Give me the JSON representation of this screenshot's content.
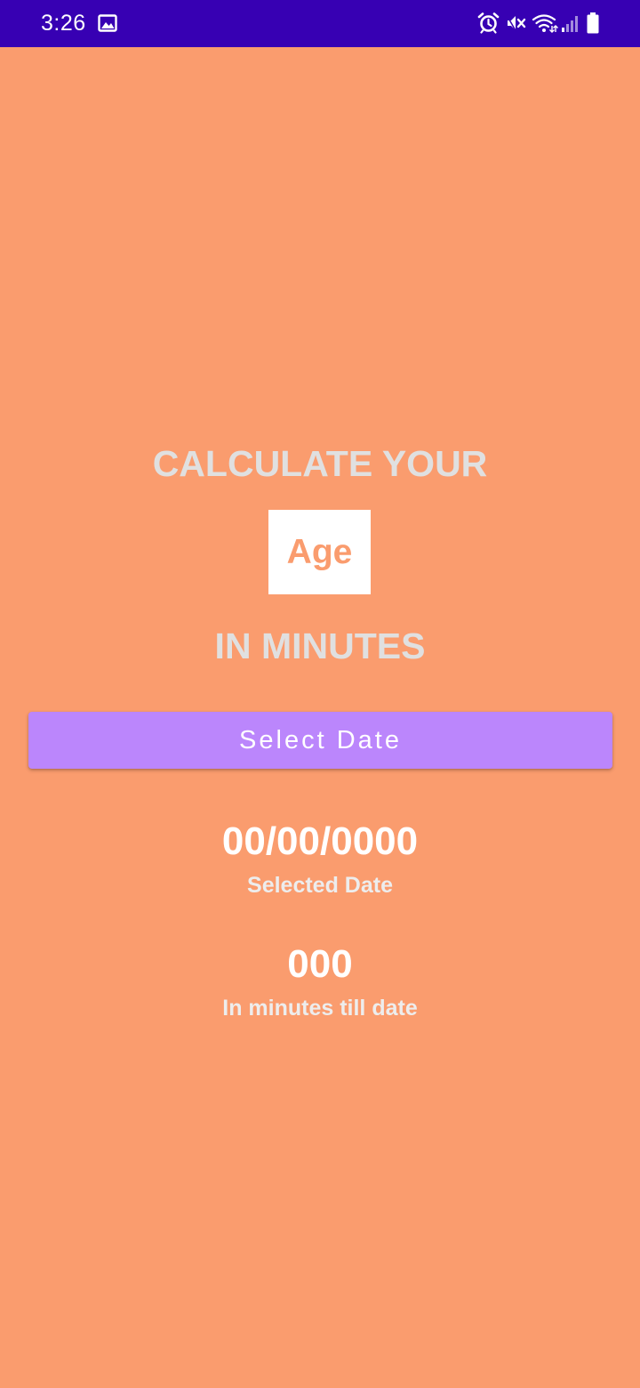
{
  "status_bar": {
    "time": "3:26",
    "icons": [
      "gallery-icon",
      "alarm-icon",
      "mute-icon",
      "wifi-icon",
      "signal-icon",
      "battery-icon"
    ],
    "background": "#3700B3"
  },
  "main": {
    "background": "#FA9C6E",
    "heading_top": "CALCULATE YOUR",
    "age_label": "Age",
    "heading_bottom": "IN MINUTES",
    "select_button_label": "Select Date",
    "button_color": "#BB86FC",
    "selected_date_value": "00/00/0000",
    "selected_date_caption": "Selected Date",
    "minutes_value": "000",
    "minutes_caption": "In minutes till date"
  }
}
